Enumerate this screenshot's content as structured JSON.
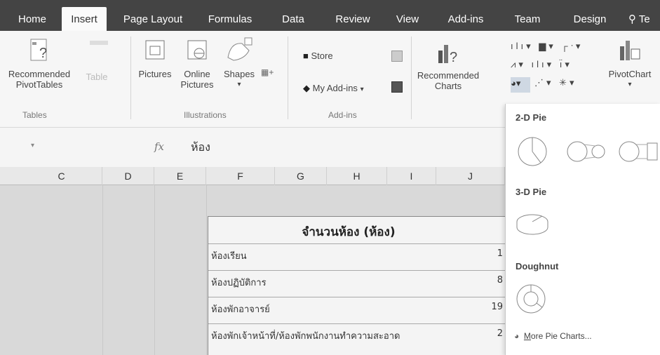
{
  "ribbon_tabs": [
    {
      "label": "Home"
    },
    {
      "label": "Insert"
    },
    {
      "label": "Page Layout"
    },
    {
      "label": "Formulas"
    },
    {
      "label": "Data"
    },
    {
      "label": "Review"
    },
    {
      "label": "View"
    },
    {
      "label": "Add-ins"
    },
    {
      "label": "Team"
    },
    {
      "label": "Design"
    },
    {
      "label": "Te"
    }
  ],
  "ribbon": {
    "recommended_pivot": "Recommended PivotTables",
    "table": "Table",
    "pictures": "Pictures",
    "online_pictures": "Online Pictures",
    "shapes": "Shapes",
    "store": "Store",
    "my_addins": "My Add-ins",
    "recommended_charts": "Recommended Charts",
    "pivotchart": "PivotChart",
    "group_tables": "Tables",
    "group_illustrations": "Illustrations",
    "group_addins": "Add-ins"
  },
  "formula_bar": {
    "fx": "fx",
    "value": "ห้อง"
  },
  "columns": [
    "C",
    "D",
    "E",
    "F",
    "G",
    "H",
    "I",
    "J"
  ],
  "table": {
    "title": "จำนวนห้อง (ห้อง)",
    "rows": [
      {
        "label": "ห้องเรียน",
        "value": "1"
      },
      {
        "label": "ห้องปฏิบัติการ",
        "value": "8"
      },
      {
        "label": "ห้องพักอาจารย์",
        "value": "19"
      },
      {
        "label": "ห้องพักเจ้าหน้าที่/ห้องพักพนักงานทำความสะอาด",
        "value": "2"
      }
    ]
  },
  "pie_menu": {
    "pie2d": "2-D Pie",
    "pie3d": "3-D Pie",
    "doughnut": "Doughnut",
    "more_key": "M",
    "more_rest": "ore Pie Charts..."
  },
  "colors": {
    "tabbar": "#444444",
    "ribbon": "#f6f6f6",
    "accent_excel": "#217346"
  }
}
